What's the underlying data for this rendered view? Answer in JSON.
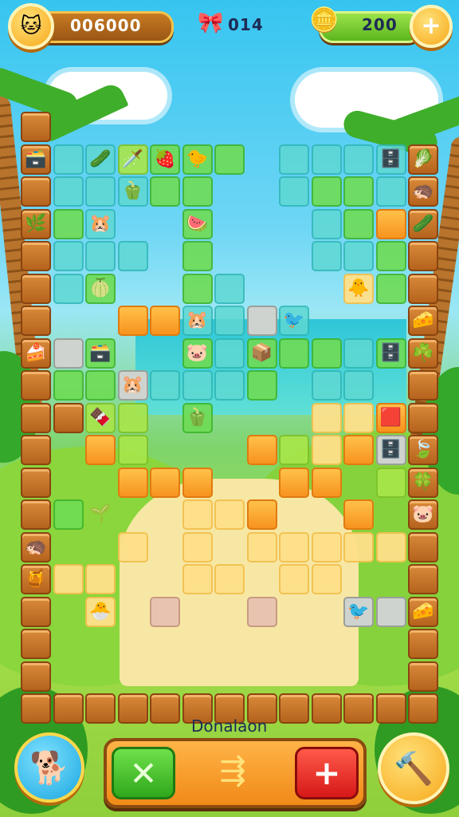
{
  "hud": {
    "score": "006000",
    "lives": "014",
    "coins": "200",
    "icons": {
      "avatar": "cat-avatar-icon",
      "lives": "heart-bow-icon",
      "coins": "gold-coins-icon",
      "add": "plus-icon"
    }
  },
  "bottom": {
    "label": "Donalaon",
    "buttons": {
      "left": "dog-avatar-icon",
      "cancel": "cross-icon",
      "middle": "arrow-banner-icon",
      "confirm": "plus-icon",
      "tool": "hammer-icon"
    }
  },
  "colors": {
    "hud_pill": "#b66a1c",
    "accent_gold": "#f7a81b",
    "cancel_green": "#3fbf2a",
    "confirm_red": "#e62a2a",
    "brick": "#c27029"
  },
  "board": {
    "tiles": [
      [
        "brick",
        0,
        0
      ],
      [
        "brick",
        0,
        1
      ],
      [
        "brick",
        0,
        2
      ],
      [
        "brick",
        0,
        3
      ],
      [
        "brick",
        0,
        4
      ],
      [
        "brick",
        0,
        5
      ],
      [
        "brick",
        0,
        6
      ],
      [
        "brick",
        0,
        7
      ],
      [
        "brick",
        0,
        8
      ],
      [
        "brick",
        0,
        9
      ],
      [
        "brick",
        0,
        10
      ],
      [
        "brick",
        0,
        11
      ],
      [
        "brick",
        0,
        12
      ],
      [
        "brick",
        0,
        13
      ],
      [
        "brick",
        0,
        14
      ],
      [
        "brick",
        0,
        15
      ],
      [
        "brick",
        0,
        16
      ],
      [
        "brick",
        0,
        17
      ],
      [
        "brick",
        0,
        18
      ],
      [
        "brick",
        12,
        1
      ],
      [
        "brick",
        12,
        2
      ],
      [
        "brick",
        12,
        3
      ],
      [
        "brick",
        12,
        4
      ],
      [
        "brick",
        12,
        5
      ],
      [
        "brick",
        12,
        6
      ],
      [
        "brick",
        12,
        7
      ],
      [
        "brick",
        12,
        8
      ],
      [
        "brick",
        12,
        9
      ],
      [
        "brick",
        12,
        10
      ],
      [
        "brick",
        12,
        11
      ],
      [
        "brick",
        12,
        12
      ],
      [
        "brick",
        12,
        13
      ],
      [
        "brick",
        12,
        14
      ],
      [
        "brick",
        12,
        15
      ],
      [
        "brick",
        12,
        16
      ],
      [
        "brick",
        12,
        17
      ],
      [
        "brick",
        12,
        18
      ],
      [
        "brick",
        1,
        18
      ],
      [
        "brick",
        2,
        18
      ],
      [
        "brick",
        3,
        18
      ],
      [
        "brick",
        4,
        18
      ],
      [
        "brick",
        5,
        18
      ],
      [
        "brick",
        6,
        18
      ],
      [
        "brick",
        7,
        18
      ],
      [
        "brick",
        8,
        18
      ],
      [
        "brick",
        9,
        18
      ],
      [
        "brick",
        10,
        18
      ],
      [
        "brick",
        11,
        18
      ],
      [
        "teal",
        1,
        1
      ],
      [
        "teal",
        2,
        1
      ],
      [
        "lime",
        3,
        1
      ],
      [
        "green",
        4,
        1
      ],
      [
        "green",
        5,
        1
      ],
      [
        "green",
        6,
        1
      ],
      [
        "teal",
        1,
        2
      ],
      [
        "teal",
        2,
        2
      ],
      [
        "teal",
        3,
        2
      ],
      [
        "green",
        4,
        2
      ],
      [
        "green",
        5,
        2
      ],
      [
        "teal",
        8,
        1
      ],
      [
        "teal",
        9,
        1
      ],
      [
        "teal",
        10,
        1
      ],
      [
        "teal",
        11,
        1
      ],
      [
        "green",
        1,
        3
      ],
      [
        "teal",
        2,
        3
      ],
      [
        "green",
        5,
        3
      ],
      [
        "teal",
        8,
        2
      ],
      [
        "green",
        9,
        2
      ],
      [
        "green",
        10,
        2
      ],
      [
        "teal",
        11,
        2
      ],
      [
        "teal",
        1,
        4
      ],
      [
        "teal",
        2,
        4
      ],
      [
        "teal",
        3,
        4
      ],
      [
        "green",
        5,
        4
      ],
      [
        "teal",
        9,
        3
      ],
      [
        "green",
        10,
        3
      ],
      [
        "orange",
        11,
        3
      ],
      [
        "teal",
        1,
        5
      ],
      [
        "green",
        2,
        5
      ],
      [
        "green",
        5,
        5
      ],
      [
        "teal",
        6,
        5
      ],
      [
        "teal",
        9,
        4
      ],
      [
        "teal",
        10,
        4
      ],
      [
        "green",
        11,
        4
      ],
      [
        "orange",
        3,
        6
      ],
      [
        "orange",
        4,
        6
      ],
      [
        "teal",
        5,
        6
      ],
      [
        "teal",
        6,
        6
      ],
      [
        "gray",
        7,
        6
      ],
      [
        "teal",
        8,
        6
      ],
      [
        "yellow",
        10,
        5
      ],
      [
        "green",
        11,
        5
      ],
      [
        "gray",
        1,
        7
      ],
      [
        "green",
        2,
        7
      ],
      [
        "green",
        5,
        7
      ],
      [
        "teal",
        6,
        7
      ],
      [
        "green",
        7,
        7
      ],
      [
        "green",
        8,
        7
      ],
      [
        "green",
        9,
        7
      ],
      [
        "teal",
        10,
        7
      ],
      [
        "green",
        11,
        7
      ],
      [
        "green",
        1,
        8
      ],
      [
        "green",
        2,
        8
      ],
      [
        "gray",
        3,
        8
      ],
      [
        "teal",
        4,
        8
      ],
      [
        "teal",
        5,
        8
      ],
      [
        "teal",
        6,
        8
      ],
      [
        "green",
        7,
        8
      ],
      [
        "teal",
        9,
        8
      ],
      [
        "teal",
        10,
        8
      ],
      [
        "brick",
        1,
        9
      ],
      [
        "lime",
        2,
        9
      ],
      [
        "lime",
        3,
        9
      ],
      [
        "green",
        5,
        9
      ],
      [
        "yellow",
        9,
        9
      ],
      [
        "yellow",
        10,
        9
      ],
      [
        "orange",
        11,
        9
      ],
      [
        "orange",
        2,
        10
      ],
      [
        "lime",
        3,
        10
      ],
      [
        "orange",
        7,
        10
      ],
      [
        "lime",
        8,
        10
      ],
      [
        "yellow",
        9,
        10
      ],
      [
        "orange",
        10,
        10
      ],
      [
        "gray",
        11,
        10
      ],
      [
        "orange",
        3,
        11
      ],
      [
        "orange",
        4,
        11
      ],
      [
        "orange",
        5,
        11
      ],
      [
        "orange",
        8,
        11
      ],
      [
        "orange",
        9,
        11
      ],
      [
        "lime",
        11,
        11
      ],
      [
        "green",
        1,
        12
      ],
      [
        "yellow",
        5,
        12
      ],
      [
        "yellow",
        6,
        12
      ],
      [
        "orange",
        7,
        12
      ],
      [
        "orange",
        10,
        12
      ],
      [
        "yellow",
        3,
        13
      ],
      [
        "yellow",
        5,
        13
      ],
      [
        "yellow",
        7,
        13
      ],
      [
        "yellow",
        8,
        13
      ],
      [
        "yellow",
        9,
        13
      ],
      [
        "yellow",
        10,
        13
      ],
      [
        "yellow",
        11,
        13
      ],
      [
        "yellow",
        1,
        14
      ],
      [
        "yellow",
        2,
        14
      ],
      [
        "yellow",
        5,
        14
      ],
      [
        "yellow",
        6,
        14
      ],
      [
        "yellow",
        8,
        14
      ],
      [
        "yellow",
        9,
        14
      ],
      [
        "yellow",
        2,
        15
      ],
      [
        "pink",
        4,
        15
      ],
      [
        "pink",
        7,
        15
      ],
      [
        "gray",
        10,
        15
      ],
      [
        "gray",
        11,
        15
      ]
    ],
    "pieces": [
      [
        "box-icon",
        0,
        1,
        "🗃️"
      ],
      [
        "leaf-icon",
        2,
        1,
        "🥒"
      ],
      [
        "sword-icon",
        3,
        1,
        "🗡️"
      ],
      [
        "tomato-icon",
        4,
        1,
        "🍓"
      ],
      [
        "bird-icon",
        5,
        1,
        "🐤"
      ],
      [
        "crate-icon",
        11,
        1,
        "🗄️"
      ],
      [
        "leaf-icon",
        12,
        1,
        "🥬"
      ],
      [
        "pepper-icon",
        3,
        2,
        "🫑"
      ],
      [
        "hedgehog-icon",
        12,
        2,
        "🦔"
      ],
      [
        "hamster-icon",
        2,
        3,
        "🐹"
      ],
      [
        "watermelon-icon",
        5,
        3,
        "🍉"
      ],
      [
        "cucumber-icon",
        12,
        3,
        "🥒"
      ],
      [
        "fern-icon",
        0,
        3,
        "🌿"
      ],
      [
        "melon-icon",
        2,
        5,
        "🍈"
      ],
      [
        "duck-icon",
        10,
        5,
        "🐥"
      ],
      [
        "hamster-icon",
        5,
        6,
        "🐹"
      ],
      [
        "bird-icon",
        8,
        6,
        "🐦"
      ],
      [
        "cheese-icon",
        12,
        6,
        "🧀"
      ],
      [
        "cake-icon",
        0,
        7,
        "🍰"
      ],
      [
        "crate-icon",
        2,
        7,
        "🗃️"
      ],
      [
        "pig-icon",
        5,
        7,
        "🐷"
      ],
      [
        "gift-icon",
        7,
        7,
        "📦"
      ],
      [
        "crate-icon",
        11,
        7,
        "🗄️"
      ],
      [
        "clover-icon",
        12,
        7,
        "☘️"
      ],
      [
        "hamster-icon",
        3,
        8,
        "🐹"
      ],
      [
        "chocolate-icon",
        2,
        9,
        "🍫"
      ],
      [
        "pepper-icon",
        5,
        9,
        "🫑"
      ],
      [
        "red-slime-icon",
        11,
        9,
        "🟥"
      ],
      [
        "crate-icon",
        11,
        10,
        "🗄️"
      ],
      [
        "leaf-icon",
        12,
        10,
        "🍃"
      ],
      [
        "leaf-icon",
        12,
        11,
        "🍀"
      ],
      [
        "grass-icon",
        2,
        12,
        "🌱"
      ],
      [
        "pig-icon",
        12,
        12,
        "🐷"
      ],
      [
        "hedgehog-icon",
        0,
        13,
        "🦔"
      ],
      [
        "jar-icon",
        0,
        14,
        "🍯"
      ],
      [
        "chick-icon",
        2,
        15,
        "🐣"
      ],
      [
        "bird-icon",
        10,
        15,
        "🐦"
      ],
      [
        "cheese-icon",
        12,
        15,
        "🧀"
      ]
    ]
  }
}
